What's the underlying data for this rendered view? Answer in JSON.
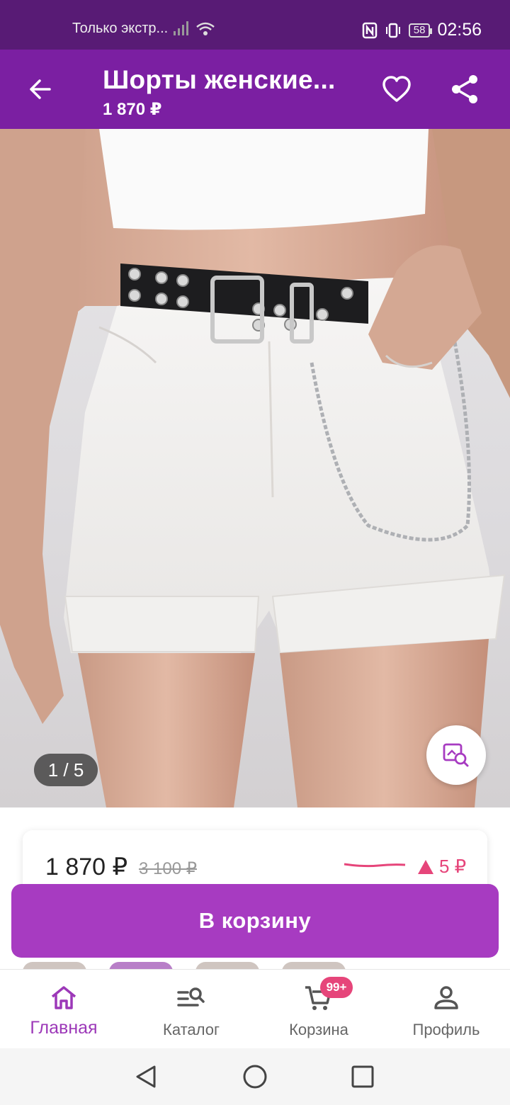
{
  "status_bar": {
    "carrier": "Только экстр...",
    "battery": "58",
    "time": "02:56"
  },
  "header": {
    "title": "Шорты женские...",
    "price": "1 870 ₽"
  },
  "gallery": {
    "counter": "1 / 5"
  },
  "price_card": {
    "current": "1 870 ₽",
    "old": "3 100 ₽",
    "change": "5 ₽",
    "accent": "#e6457a"
  },
  "actions": {
    "add_to_cart": "В корзину"
  },
  "bottom_nav": {
    "items": [
      {
        "label": "Главная",
        "icon": "home-icon",
        "active": true
      },
      {
        "label": "Каталог",
        "icon": "catalog-search-icon",
        "active": false
      },
      {
        "label": "Корзина",
        "icon": "cart-icon",
        "badge": "99+",
        "active": false
      },
      {
        "label": "Профиль",
        "icon": "profile-icon",
        "active": false
      }
    ]
  },
  "colors": {
    "status_bar": "#581b75",
    "header": "#7b1fa2",
    "button": "#a73bc1",
    "active_nav": "#9c38b8"
  }
}
